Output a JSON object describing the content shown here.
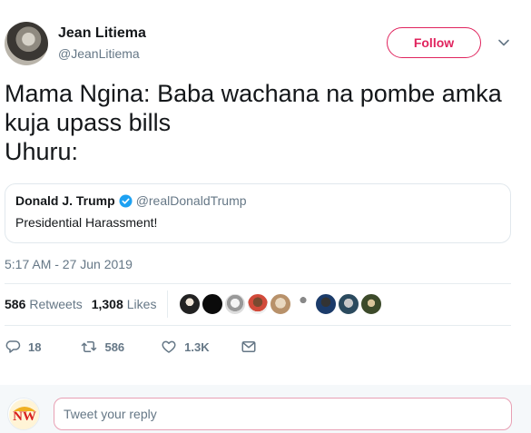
{
  "author": {
    "name": "Jean Litiema",
    "handle": "@JeanLitiema"
  },
  "follow_label": "Follow",
  "tweet_lines": "Mama Ngina: Baba wachana na pombe amka kuja upass bills\nUhuru:",
  "quoted_tweet": {
    "name": "Donald J. Trump",
    "handle": "@realDonaldTrump",
    "text": "Presidential Harassment!"
  },
  "timestamp": "5:17 AM - 27 Jun 2019",
  "stats": {
    "retweets_count": "586",
    "retweets_label": "Retweets",
    "likes_count": "1,308",
    "likes_label": "Likes"
  },
  "actions": {
    "reply_count": "18",
    "retweet_count": "586",
    "like_count": "1.3K"
  },
  "reply": {
    "placeholder": "Tweet your reply",
    "avatar_text": "NW"
  },
  "colors": {
    "accent": "#e0245e",
    "verified": "#1da1f2",
    "muted": "#657786"
  },
  "icons": [
    "chevron-down-icon",
    "verified-badge-icon",
    "reply-icon",
    "retweet-icon",
    "heart-icon",
    "message-icon"
  ]
}
